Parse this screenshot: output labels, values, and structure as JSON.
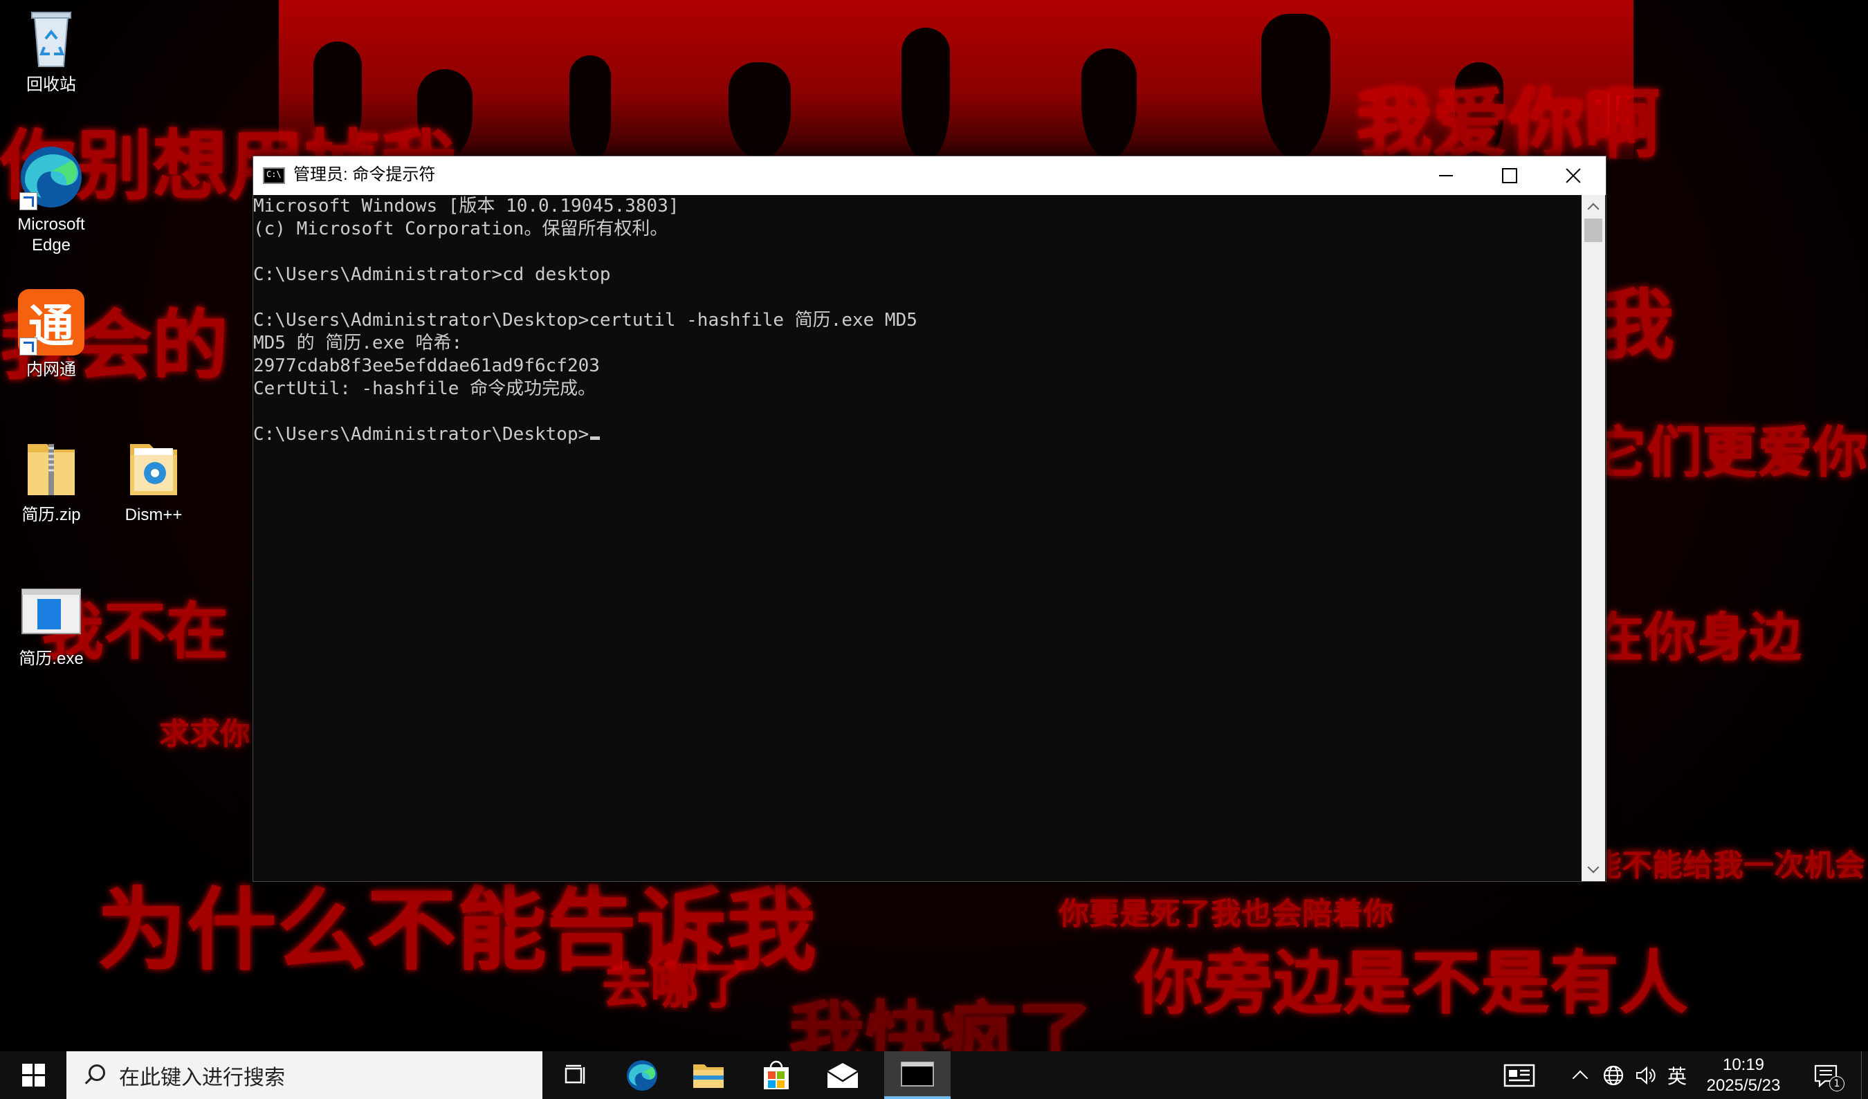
{
  "desktop": {
    "icons": [
      {
        "name": "recycle-bin",
        "label": "回收站"
      },
      {
        "name": "microsoft-edge",
        "label": "Microsoft\nEdge"
      },
      {
        "name": "neiwangtong",
        "label": "内网通"
      },
      {
        "name": "resume-zip",
        "label": "简历.zip"
      },
      {
        "name": "dism-plus-plus",
        "label": "Dism++"
      },
      {
        "name": "resume-exe",
        "label": "简历.exe"
      }
    ],
    "edge_label_line1": "Microsoft",
    "edge_label_line2": "Edge",
    "wallpaper_text": [
      "你别想用掉我",
      "我会的",
      "我爱你啊",
      "我",
      "它们更爱你",
      "我不在",
      "在你身边",
      "求求你",
      "能不能给我一次机会",
      "为什么不能告诉我",
      "你要是死了我也会陪着你",
      "去哪了",
      "你旁边是不是有人",
      "我快疯了"
    ]
  },
  "cmd_window": {
    "title": "管理员: 命令提示符",
    "icon_text": "C:\\",
    "lines": [
      "Microsoft Windows [版本 10.0.19045.3803]",
      "(c) Microsoft Corporation。保留所有权利。",
      "",
      "C:\\Users\\Administrator>cd desktop",
      "",
      "C:\\Users\\Administrator\\Desktop>certutil -hashfile 简历.exe MD5",
      "MD5 的 简历.exe 哈希:",
      "2977cdab8f3ee5efddae61ad9f6cf203",
      "CertUtil: -hashfile 命令成功完成。",
      "",
      "C:\\Users\\Administrator\\Desktop>"
    ]
  },
  "taskbar": {
    "search_placeholder": "在此键入进行搜索",
    "ime_label": "英",
    "time": "10:19",
    "date": "2025/5/23",
    "notification_count": "1"
  },
  "colors": {
    "console_bg": "#0c0c0c",
    "console_fg": "#cccccc",
    "wallpaper_red": "#c00000",
    "taskbar_bg": "#101010"
  }
}
